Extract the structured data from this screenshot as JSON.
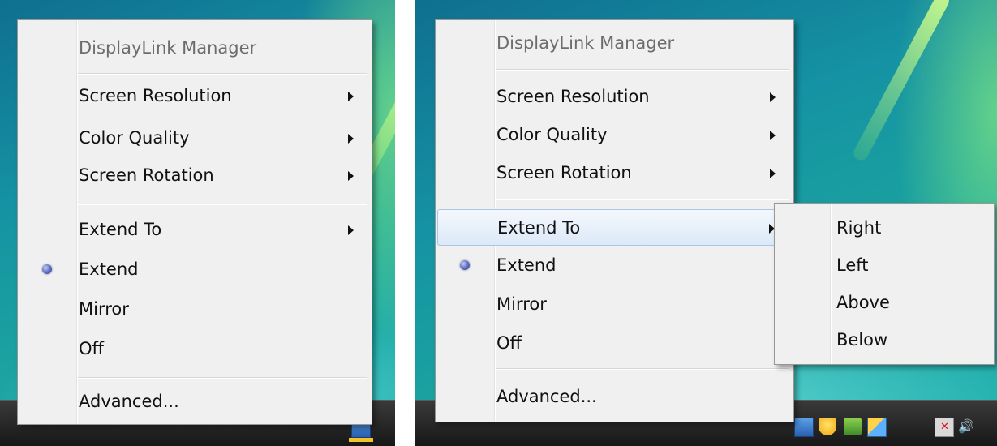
{
  "left_menu": {
    "title": "DisplayLink Manager",
    "items": [
      {
        "label": "Screen Resolution",
        "submenu": true
      },
      {
        "label": "Color Quality",
        "submenu": true
      },
      {
        "label": "Screen Rotation",
        "submenu": true
      },
      {
        "label": "Extend To",
        "submenu": true
      },
      {
        "label": "Extend",
        "selected": true
      },
      {
        "label": "Mirror"
      },
      {
        "label": "Off"
      },
      {
        "label": "Advanced..."
      }
    ]
  },
  "right_menu": {
    "title": "DisplayLink Manager",
    "items": [
      {
        "label": "Screen Resolution",
        "submenu": true
      },
      {
        "label": "Color Quality",
        "submenu": true
      },
      {
        "label": "Screen Rotation",
        "submenu": true
      },
      {
        "label": "Extend To",
        "submenu": true,
        "highlighted": true
      },
      {
        "label": "Extend",
        "selected": true
      },
      {
        "label": "Mirror"
      },
      {
        "label": "Off"
      },
      {
        "label": "Advanced..."
      }
    ],
    "extend_to_submenu": [
      "Right",
      "Left",
      "Above",
      "Below"
    ]
  },
  "tray_icons": [
    "monitor-icon",
    "shield-icon",
    "update-icon",
    "window-icon",
    "network-icon",
    "speaker-icon"
  ],
  "colors": {
    "menu_bg": "#f0f0f0",
    "highlight": "#dce9f7",
    "wallpaper": "#1592a3",
    "taskbar": "#1e1e1e"
  }
}
